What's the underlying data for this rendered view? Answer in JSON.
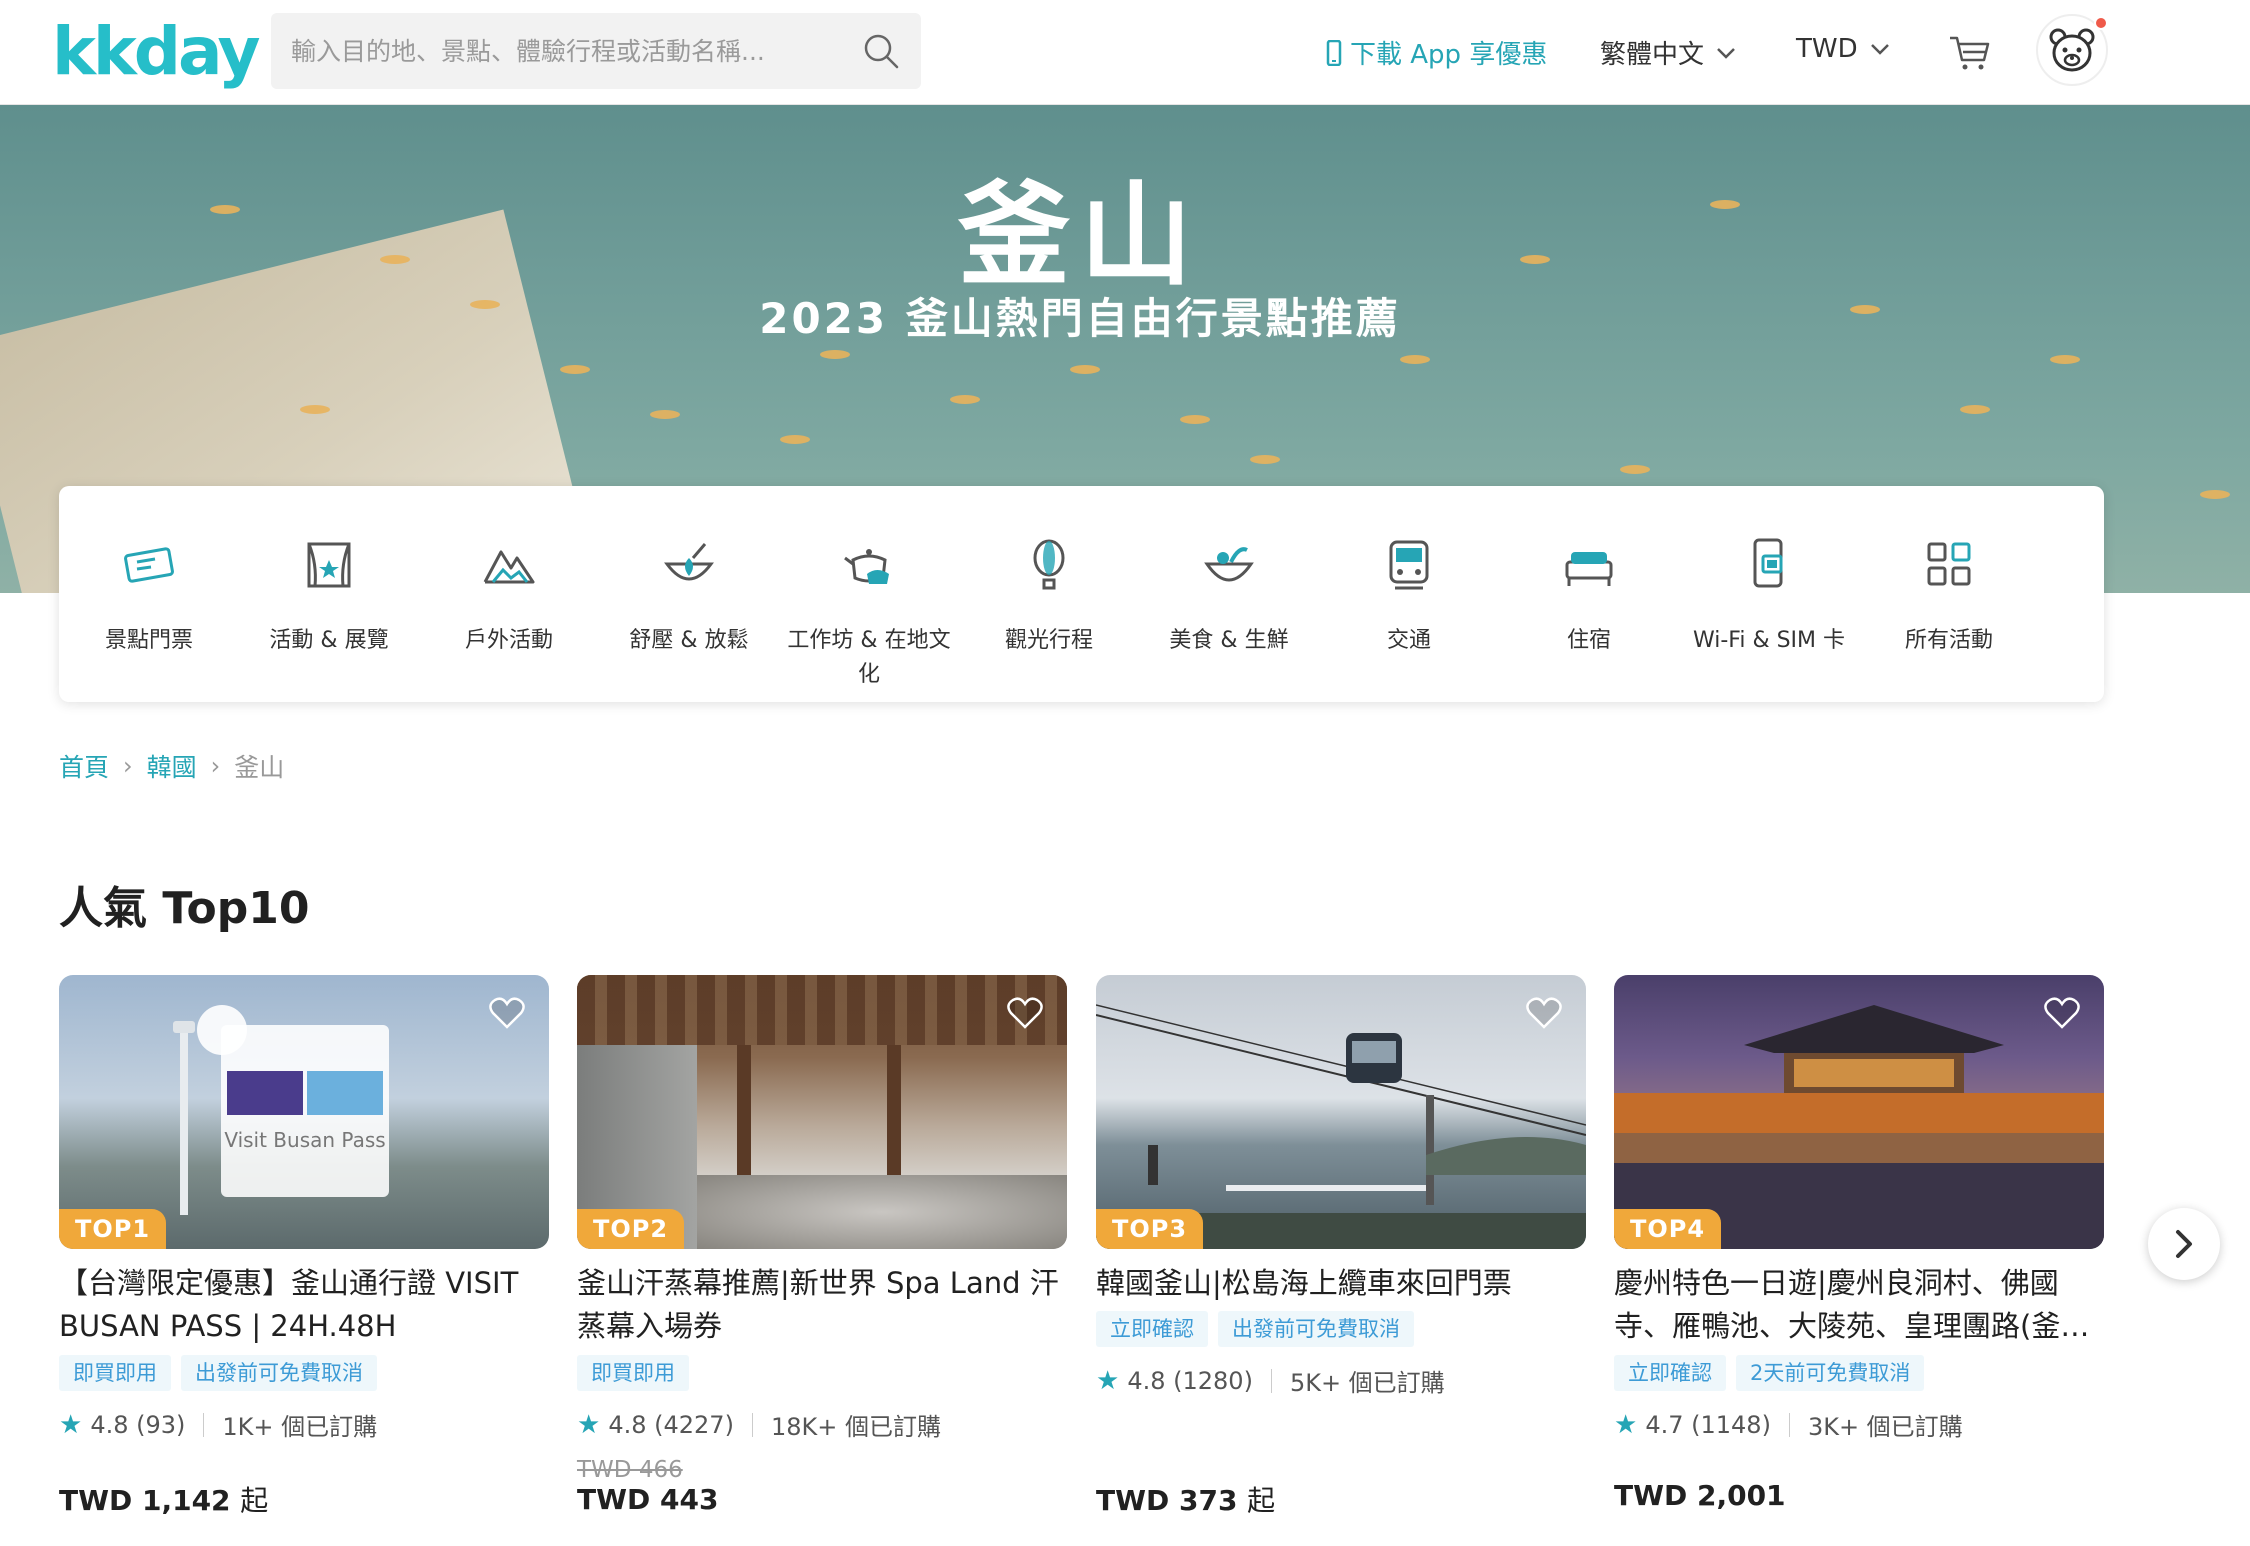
{
  "header": {
    "logo": "kkday",
    "search_placeholder": "輸入目的地、景點、體驗行程或活動名稱...",
    "app_link": "下載 App 享優惠",
    "language": "繁體中文",
    "currency": "TWD"
  },
  "hero": {
    "title": "釜山",
    "subtitle": "2023 釜山熱門自由行景點推薦"
  },
  "categories": [
    {
      "label": "景點門票",
      "icon": "ticket-icon"
    },
    {
      "label": "活動 & 展覽",
      "icon": "theater-icon"
    },
    {
      "label": "戶外活動",
      "icon": "mountain-icon"
    },
    {
      "label": "舒壓 & 放鬆",
      "icon": "spa-bowl-icon"
    },
    {
      "label": "工作坊 & 在地文化",
      "icon": "teapot-icon"
    },
    {
      "label": "觀光行程",
      "icon": "balloon-icon"
    },
    {
      "label": "美食 & 生鮮",
      "icon": "food-bowl-icon"
    },
    {
      "label": "交通",
      "icon": "train-icon"
    },
    {
      "label": "住宿",
      "icon": "bed-icon"
    },
    {
      "label": "Wi-Fi & SIM 卡",
      "icon": "phone-sim-icon"
    },
    {
      "label": "所有活動",
      "icon": "grid-icon"
    }
  ],
  "breadcrumb": {
    "home": "首頁",
    "country": "韓國",
    "current": "釜山"
  },
  "section": {
    "title": "人氣 Top10"
  },
  "products": [
    {
      "badge": "TOP1",
      "title": "【台灣限定優惠】釜山通行證 VISIT BUSAN PASS | 24H.48H",
      "image_caption": "Visit Busan Pass",
      "tags": [
        "即買即用",
        "出發前可免費取消"
      ],
      "rating": "4.8",
      "reviews": "(93)",
      "booked": "1K+ 個已訂購",
      "old_price": "",
      "price": "TWD 1,142",
      "price_suffix": "起"
    },
    {
      "badge": "TOP2",
      "title": "釜山汗蒸幕推薦|新世界 Spa Land 汗蒸幕入場券",
      "tags": [
        "即買即用"
      ],
      "rating": "4.8",
      "reviews": "(4227)",
      "booked": "18K+ 個已訂購",
      "old_price": "TWD 466",
      "price": "TWD 443",
      "price_suffix": ""
    },
    {
      "badge": "TOP3",
      "title": "韓國釜山|松島海上纜車來回門票",
      "tags": [
        "立即確認",
        "出發前可免費取消"
      ],
      "rating": "4.8",
      "reviews": "(1280)",
      "booked": "5K+ 個已訂購",
      "old_price": "",
      "price": "TWD 373",
      "price_suffix": "起"
    },
    {
      "badge": "TOP4",
      "title": "慶州特色一日遊|慶州良洞村、佛國寺、雁鴨池、大陵苑、皇理團路(釜…",
      "tags": [
        "立即確認",
        "2天前可免費取消"
      ],
      "rating": "4.7",
      "reviews": "(1148)",
      "booked": "3K+ 個已訂購",
      "old_price": "",
      "price": "TWD 2,001",
      "price_suffix": ""
    }
  ],
  "colors": {
    "brand": "#26bec9",
    "link": "#26a5b5",
    "badge": "#f0a83a",
    "tag_bg": "#eef7fb",
    "tag_text": "#3d9bd6"
  }
}
